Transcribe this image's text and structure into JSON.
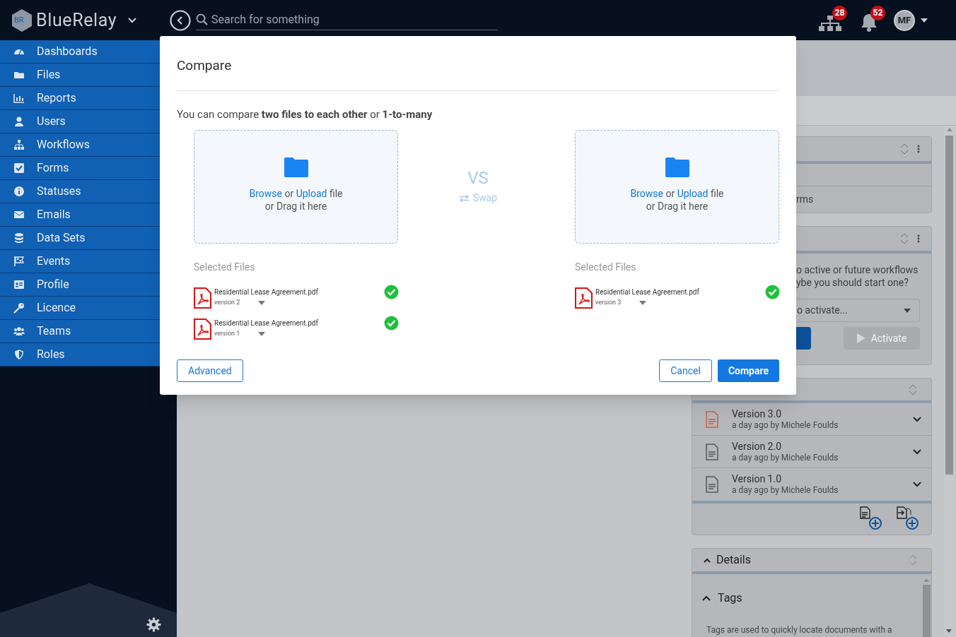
{
  "app": {
    "brand_mark": "BR",
    "brand": "BlueRelay",
    "search": {
      "placeholder": "Search for something"
    },
    "workflow_count": "28",
    "notification_count": "52",
    "user_initials": "MF"
  },
  "sidebar": {
    "items": [
      {
        "label": "Dashboards"
      },
      {
        "label": "Files"
      },
      {
        "label": "Reports"
      },
      {
        "label": "Users"
      },
      {
        "label": "Workflows"
      },
      {
        "label": "Forms"
      },
      {
        "label": "Statuses"
      },
      {
        "label": "Emails"
      },
      {
        "label": "Data Sets"
      },
      {
        "label": "Events"
      },
      {
        "label": "Profile"
      },
      {
        "label": "Licence"
      },
      {
        "label": "Teams"
      },
      {
        "label": "Roles"
      }
    ]
  },
  "background": {
    "forms_panel": {
      "row": "rms"
    },
    "workflow_panel": {
      "message_line_1": "o active or future workflows",
      "message_line_2": "ybe you should start one?",
      "select": {
        "placeholder": "o activate..."
      },
      "activate_button": "Activate"
    },
    "versions": [
      {
        "title": "Version 3.0",
        "meta": "a day ago by Michele Foulds",
        "current": true
      },
      {
        "title": "Version 2.0",
        "meta": "a day ago by Michele Foulds",
        "current": false
      },
      {
        "title": "Version 1.0",
        "meta": "a day ago by Michele Foulds",
        "current": false
      }
    ],
    "details": {
      "title": "Details",
      "tags_title": "Tags",
      "tags_text": "Tags are used to quickly locate documents with a"
    }
  },
  "dialog": {
    "title": "Compare",
    "intro": "You can compare **two files to each other** or **1-to-many**",
    "vs": "VS",
    "swap": "Swap",
    "sides": [
      {
        "browse": "Browse",
        "or": "or",
        "upload": "Upload",
        "file": "file",
        "drag": "or Drag it here",
        "selected_label": "Selected Files",
        "files": [
          {
            "name": "Residential Lease Agreement.pdf",
            "version": "version 2",
            "valid": true
          },
          {
            "name": "Residential Lease Agreement.pdf",
            "version": "version 1",
            "valid": true
          }
        ]
      },
      {
        "browse": "Browse",
        "or": "or",
        "upload": "Upload",
        "file": "file",
        "drag": "or Drag it here",
        "selected_label": "Selected Files",
        "files": [
          {
            "name": "Residential Lease Agreement.pdf",
            "version": "version 3",
            "valid": true
          }
        ]
      }
    ],
    "buttons": {
      "advanced": "Advanced",
      "cancel": "Cancel",
      "compare": "Compare"
    }
  }
}
